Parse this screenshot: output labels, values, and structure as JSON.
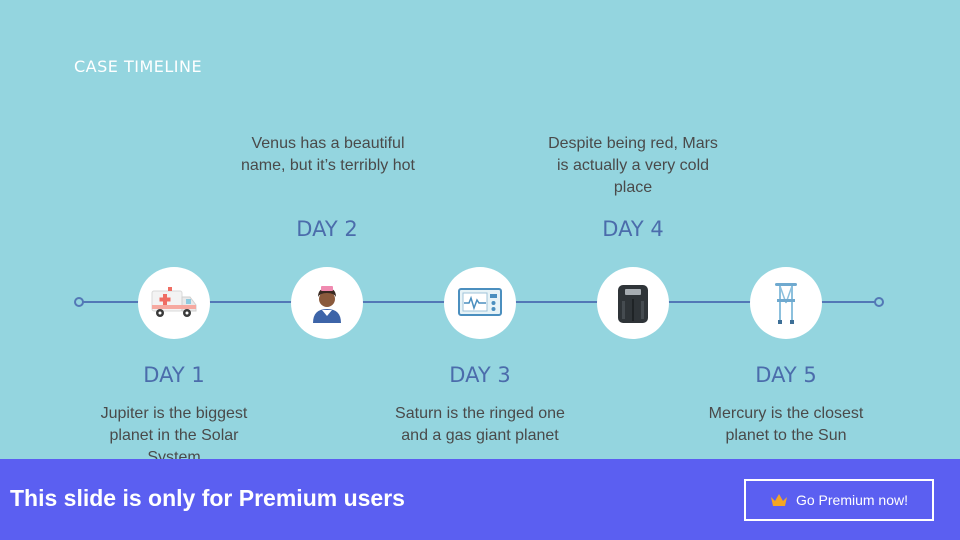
{
  "slide": {
    "title": "CASE TIMELINE",
    "days": [
      {
        "label": "DAY 1",
        "text": "Jupiter is the biggest planet in the Solar System",
        "icon": "ambulance-icon"
      },
      {
        "label": "DAY 2",
        "text": "Venus has a beautiful name, but it’s terribly hot",
        "icon": "nurse-icon"
      },
      {
        "label": "DAY 3",
        "text": "Saturn is the ringed one and a gas giant planet",
        "icon": "medical-monitor-icon"
      },
      {
        "label": "DAY 4",
        "text": "Despite being red, Mars is actually a very cold place",
        "icon": "scale-icon"
      },
      {
        "label": "DAY 5",
        "text": "Mercury is the closest planet to the Sun",
        "icon": "crutches-icon"
      }
    ]
  },
  "banner": {
    "text": "This slide is only for Premium users",
    "button_label": "Go Premium now!"
  },
  "colors": {
    "background": "#94d5df",
    "accent": "#4b6cab",
    "banner": "#5b5ff1"
  }
}
